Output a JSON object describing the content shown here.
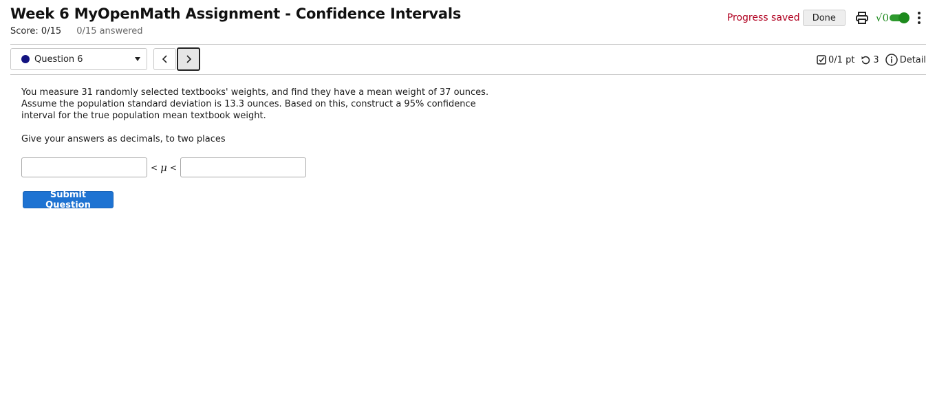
{
  "assignment": {
    "title": "Week 6 MyOpenMath Assignment - Confidence Intervals",
    "score": "Score: 0/15",
    "answered": "0/15 answered"
  },
  "toolbar": {
    "progress_status": "Progress saved",
    "done_label": "Done",
    "sqrt_symbol": "√0",
    "print_icon": "printer-icon",
    "toggle_state": "on",
    "menu_icon": "kebab-menu-icon",
    "accent_color": "#1d8a1d",
    "status_color": "#b00020"
  },
  "navigation": {
    "question_select": "Question 6",
    "prev_icon": "chevron-left-icon",
    "next_icon": "chevron-right-icon"
  },
  "question_meta": {
    "points": "0/1 pt",
    "tries": "3",
    "detail": "Detail"
  },
  "question": {
    "text": "You measure 31 randomly selected textbooks' weights, and find they have a mean weight of 37 ounces. Assume the population standard deviation is 13.3 ounces. Based on this, construct a 95% confidence interval for the true population mean textbook weight.",
    "instructions": "Give your answers as decimals, to two places",
    "lt_symbol": "<",
    "mu_symbol": "μ",
    "lower_value": "",
    "upper_value": "",
    "submit_label": "Submit Question",
    "submit_color": "#1e73d2"
  }
}
